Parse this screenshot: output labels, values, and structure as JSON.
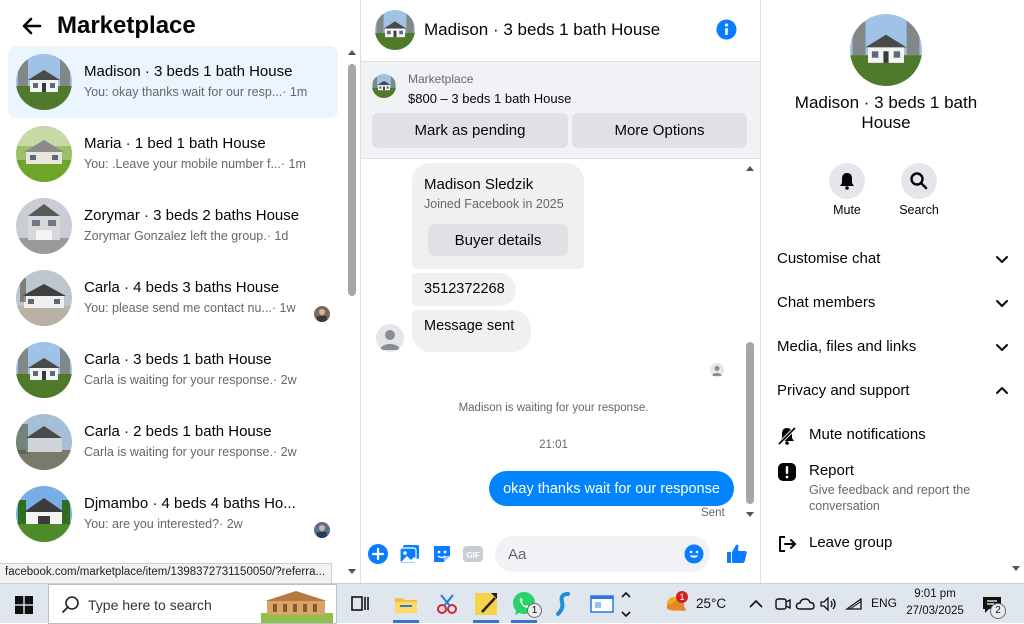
{
  "left": {
    "title": "Marketplace",
    "conversations": [
      {
        "name": "Madison · 3 beds 1 bath House",
        "preview": "You: okay thanks wait for our resp...",
        "time": " · 1m",
        "active": true
      },
      {
        "name": "Maria · 1 bed 1 bath House",
        "preview": "You: .Leave your mobile number f...",
        "time": " · 1m"
      },
      {
        "name": "Zorymar · 3 beds 2 baths House",
        "preview": "Zorymar Gonzalez left the group.",
        "time": " · 1d"
      },
      {
        "name": "Carla · 4 beds 3 baths House",
        "preview": "You: please send me contact nu...",
        "time": " · 1w"
      },
      {
        "name": "Carla · 3 beds 1 bath House",
        "preview": "Carla is waiting for your response.",
        "time": " · 2w"
      },
      {
        "name": "Carla · 2 beds 1 bath House",
        "preview": "Carla is waiting for your response.",
        "time": " · 2w"
      },
      {
        "name": "Djmambo · 4 beds 4 baths Ho...",
        "preview": "You: are you interested?",
        "time": " · 2w"
      }
    ],
    "status_url": "facebook.com/marketplace/item/1398372731150050/?referra..."
  },
  "center": {
    "title": "Madison · 3 beds 1 bath House",
    "listing_label": "Marketplace",
    "listing_price": "$800 – 3 beds 1 bath House",
    "mark_pending": "Mark as pending",
    "more_options": "More Options",
    "buyer_name": "Madison Sledzik",
    "buyer_joined": "Joined Facebook in 2025",
    "buyer_details": "Buyer details",
    "phone": "3512372268",
    "message_sent": "Message sent",
    "system_msg": "Madison is waiting for your response.",
    "time": "21:01",
    "my_message": "okay thanks wait for our response",
    "sent_label": "Sent",
    "composer_placeholder": "Aa"
  },
  "right": {
    "title": "Madison · 3 beds 1 bath House",
    "mute": "Mute",
    "search": "Search",
    "customise": "Customise chat",
    "members": "Chat members",
    "media": "Media, files and links",
    "privacy": "Privacy and support",
    "mute_notifications": "Mute notifications",
    "report": "Report",
    "report_sub": "Give feedback and report the conversation",
    "leave": "Leave group"
  },
  "taskbar": {
    "search_text": "Type here to search",
    "temperature": "25°C",
    "weather_badge": "1",
    "whatsapp_badge": "1",
    "language": "ENG",
    "time": "9:01 pm",
    "date": "27/03/2025",
    "notif_count": "2"
  },
  "colors": {
    "accent": "#0084ff",
    "active_row": "#ebf5ff"
  }
}
